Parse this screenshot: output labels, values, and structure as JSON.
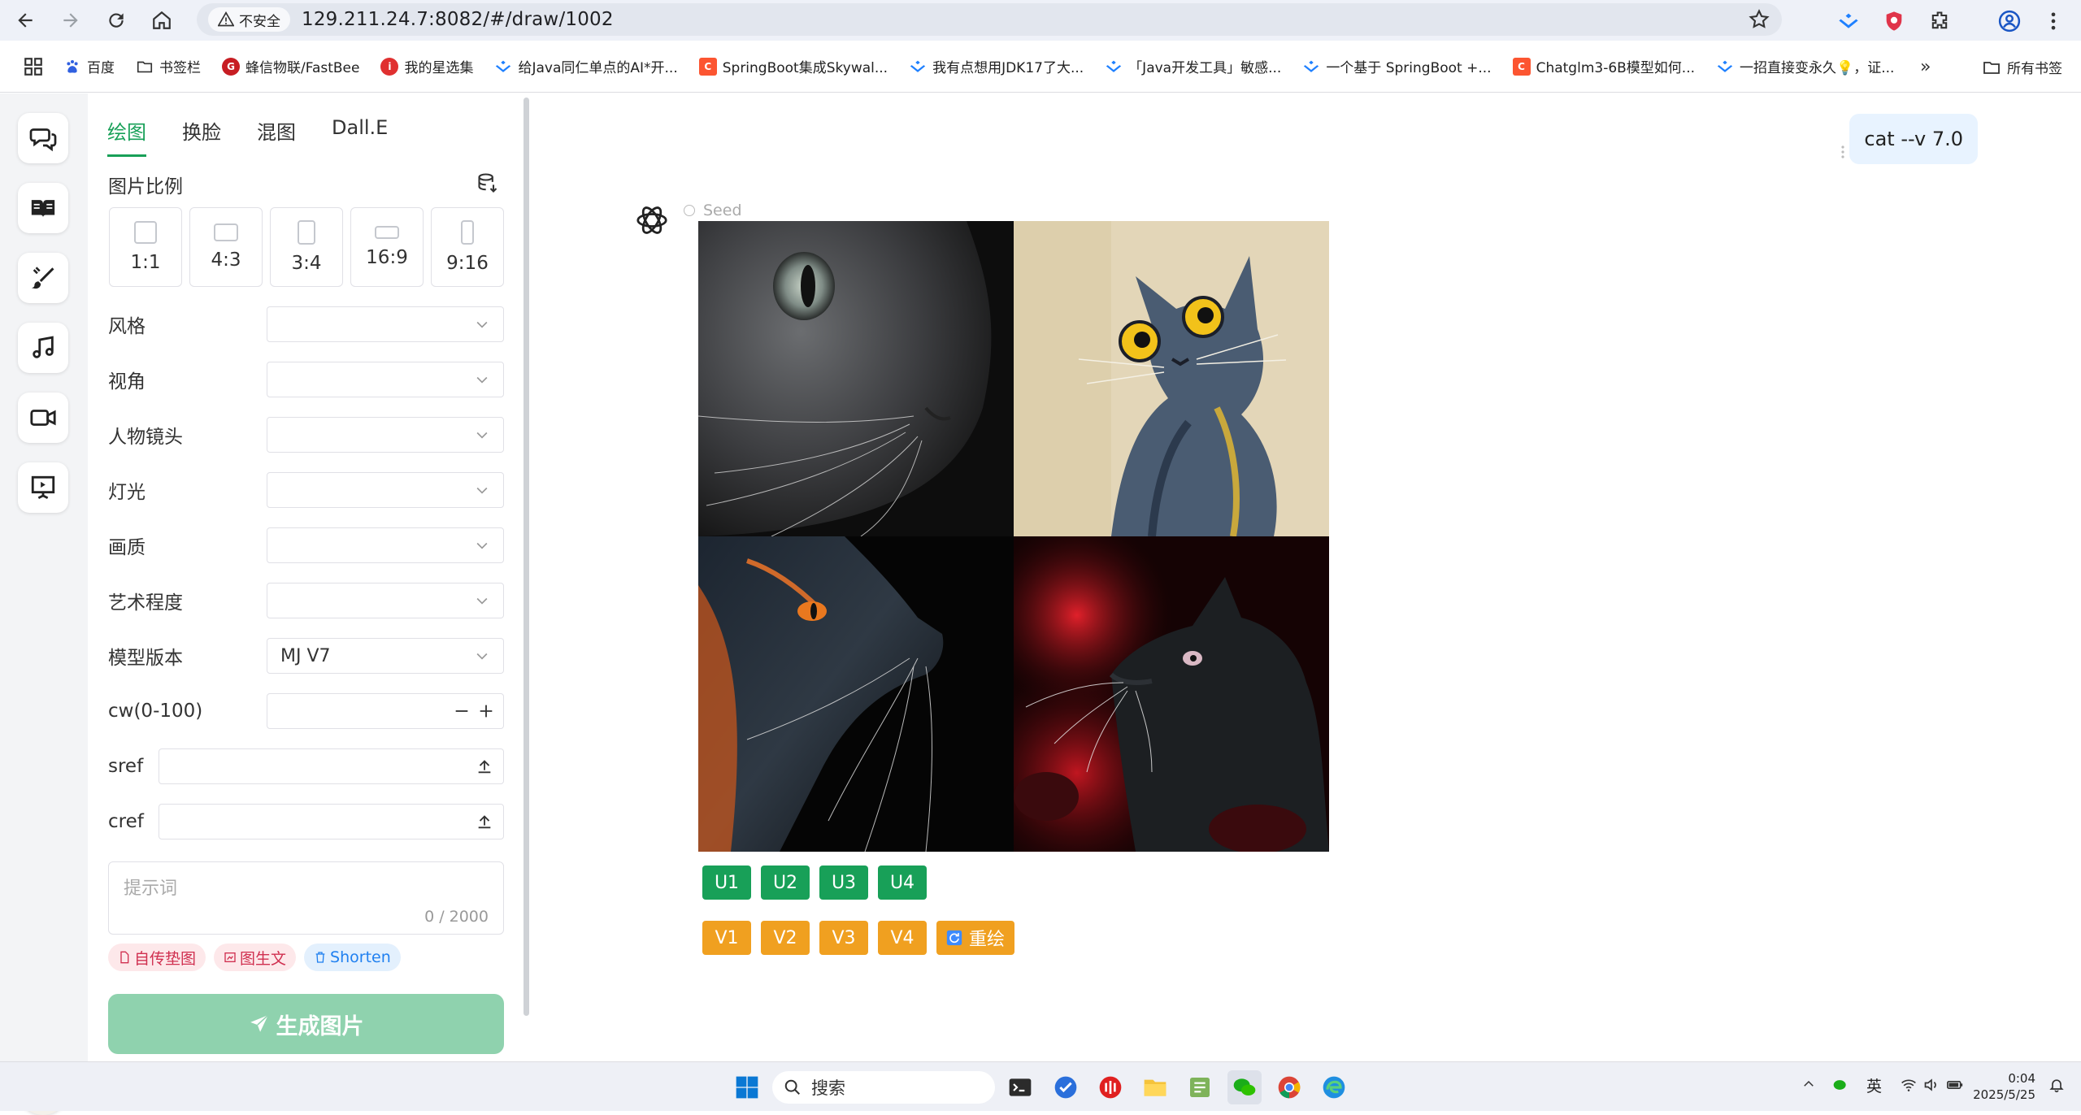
{
  "browser": {
    "security_label": "不安全",
    "url": "129.211.24.7:8082/#/draw/1002"
  },
  "bookmarks": [
    {
      "label": "百度",
      "icon": "baidu-icon",
      "color": "#3060e0"
    },
    {
      "label": "书签栏",
      "icon": "folder-icon",
      "color": "#555555"
    },
    {
      "label": "蜂信物联/FastBee",
      "icon": "gitee-icon",
      "color": "#c71d23"
    },
    {
      "label": "我的星选集",
      "icon": "site-icon",
      "color": "#e03030"
    },
    {
      "label": "给Java同仁单点的AI*开...",
      "icon": "juejin-icon",
      "color": "#1e80ff"
    },
    {
      "label": "SpringBoot集成Skywal...",
      "icon": "csdn-icon",
      "color": "#fc5531"
    },
    {
      "label": "我有点想用JDK17了大...",
      "icon": "juejin-icon",
      "color": "#1e80ff"
    },
    {
      "label": "「Java开发工具」敏感...",
      "icon": "juejin-icon",
      "color": "#1e80ff"
    },
    {
      "label": "一个基于 SpringBoot +...",
      "icon": "juejin-icon",
      "color": "#1e80ff"
    },
    {
      "label": "Chatglm3-6B模型如何...",
      "icon": "csdn-icon",
      "color": "#fc5531"
    },
    {
      "label": "一招直接变永久💡，证...",
      "icon": "juejin-icon",
      "color": "#1e80ff"
    }
  ],
  "all_bookmarks_label": "所有书签",
  "panel": {
    "tabs": [
      {
        "label": "绘图",
        "active": true
      },
      {
        "label": "换脸",
        "active": false
      },
      {
        "label": "混图",
        "active": false
      },
      {
        "label": "Dall.E",
        "active": false
      }
    ],
    "ratio_title": "图片比例",
    "ratios": [
      "1:1",
      "4:3",
      "3:4",
      "16:9",
      "9:16"
    ],
    "fields": {
      "style": {
        "label": "风格",
        "value": ""
      },
      "view": {
        "label": "视角",
        "value": ""
      },
      "shot": {
        "label": "人物镜头",
        "value": ""
      },
      "light": {
        "label": "灯光",
        "value": ""
      },
      "quality": {
        "label": "画质",
        "value": ""
      },
      "art": {
        "label": "艺术程度",
        "value": ""
      },
      "model": {
        "label": "模型版本",
        "value": "MJ V7"
      },
      "cw": {
        "label": "cw(0-100)",
        "value": ""
      },
      "sref": {
        "label": "sref",
        "value": ""
      },
      "cref": {
        "label": "cref",
        "value": ""
      }
    },
    "prompt_placeholder": "提示词",
    "prompt_count": "0 / 2000",
    "tags": [
      "自传垫图",
      "图生文",
      "Shorten"
    ],
    "generate_label": "生成图片"
  },
  "chat": {
    "user_message": "cat --v 7.0",
    "seed_label": "Seed",
    "upscale_buttons": [
      "U1",
      "U2",
      "U3",
      "U4"
    ],
    "variation_buttons": [
      "V1",
      "V2",
      "V3",
      "V4"
    ],
    "redraw_label": "重绘",
    "colors": {
      "green": "#18a058",
      "orange": "#f0a020"
    }
  },
  "taskbar": {
    "search_placeholder": "搜索",
    "ime": "英",
    "time": "0:04",
    "date": "2025/5/25"
  }
}
